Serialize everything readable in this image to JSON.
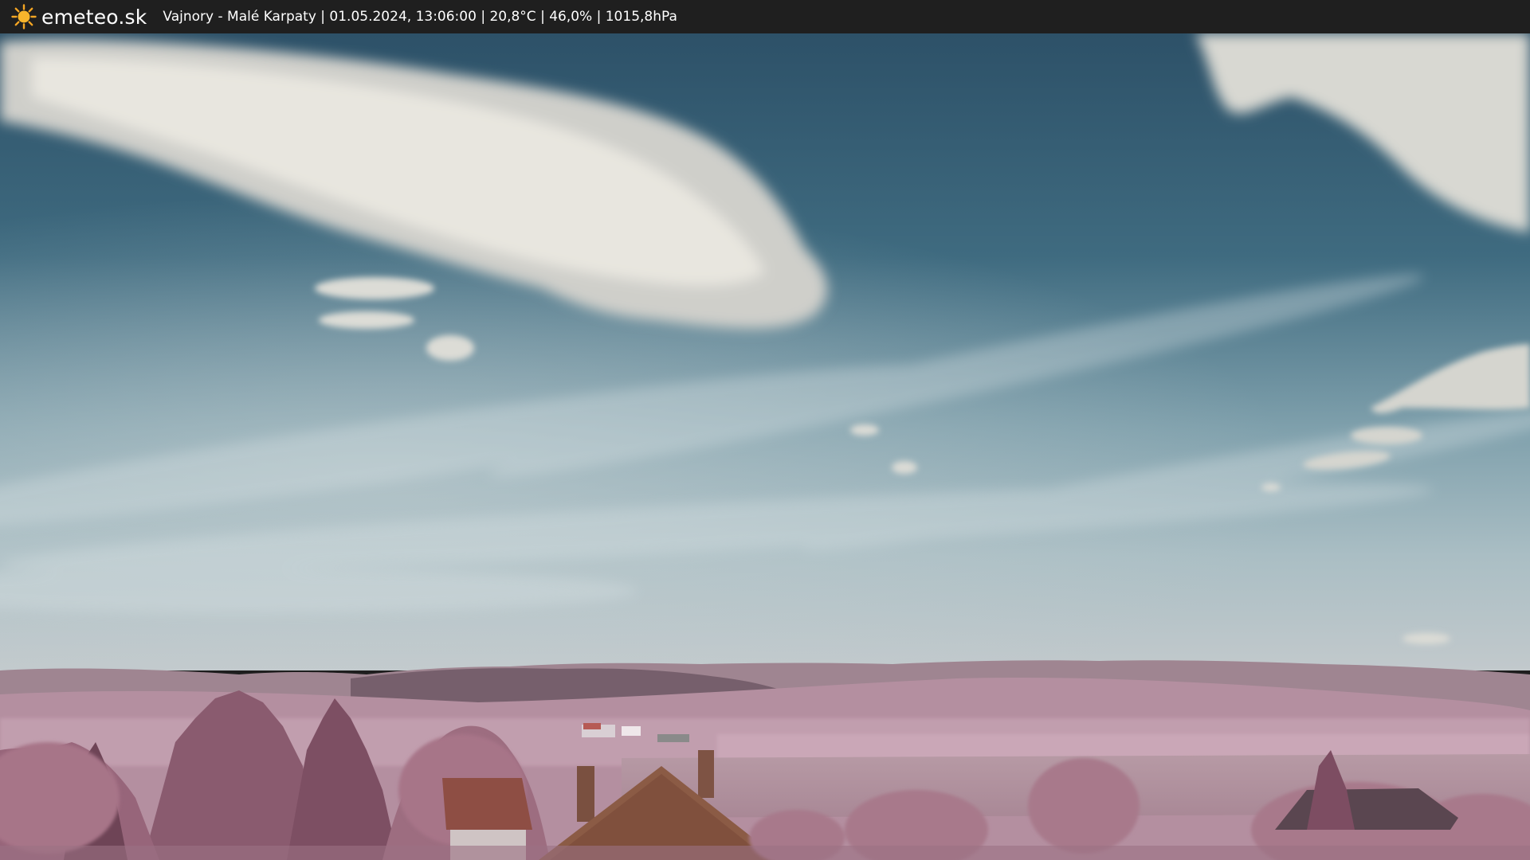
{
  "header": {
    "brand": "emeteo.sk",
    "logo_icon": "sun-icon",
    "info": "Vajnory - Malé Karpaty | 01.05.2024, 13:06:00 | 20,8°C | 46,0% | 1015,8hPa"
  },
  "colors": {
    "bar_background": "#1f1f1f",
    "sun": "#f5a623",
    "sky_top": "#2f5570",
    "sky_bottom": "#b6c6cc",
    "hills": "#9c7a8c",
    "trees": "#8c5c70",
    "roof": "#8c5a42"
  }
}
